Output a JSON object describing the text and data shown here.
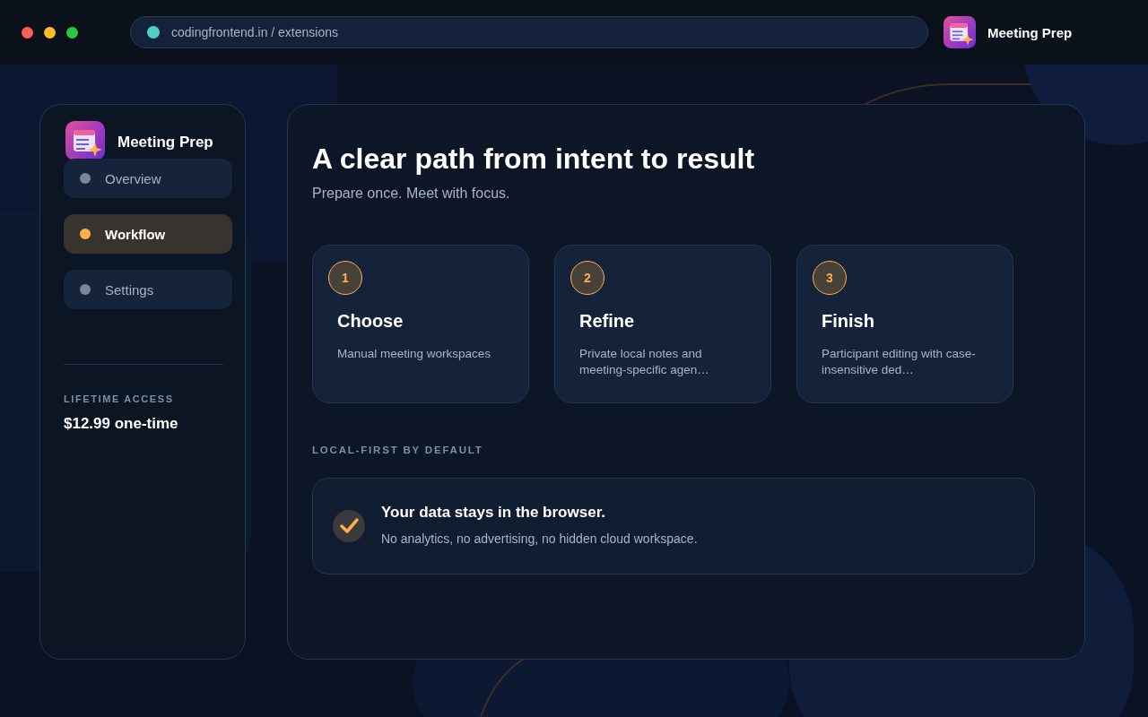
{
  "address_bar": {
    "url": "codingfrontend.in / extensions"
  },
  "app": {
    "name": "Meeting Prep"
  },
  "sidebar": {
    "title": "Meeting Prep",
    "items": [
      {
        "label": "Overview",
        "selected": false
      },
      {
        "label": "Workflow",
        "selected": true
      },
      {
        "label": "Settings",
        "selected": false
      }
    ],
    "price_label": "LIFETIME ACCESS",
    "price": "$12.99 one-time"
  },
  "main": {
    "title": "A clear path from intent to result",
    "subtitle": "Prepare once. Meet with focus.",
    "steps": [
      {
        "number": "1",
        "title": "Choose",
        "description": "Manual meeting workspaces"
      },
      {
        "number": "2",
        "title": "Refine",
        "description": "Private local notes and meeting-specific agen…"
      },
      {
        "number": "3",
        "title": "Finish",
        "description": "Participant editing with case-insensitive ded…"
      }
    ],
    "section_label": "LOCAL-FIRST BY DEFAULT",
    "notice": {
      "title": "Your data stays in the browser.",
      "text": "No analytics, no advertising, no hidden cloud workspace."
    }
  }
}
